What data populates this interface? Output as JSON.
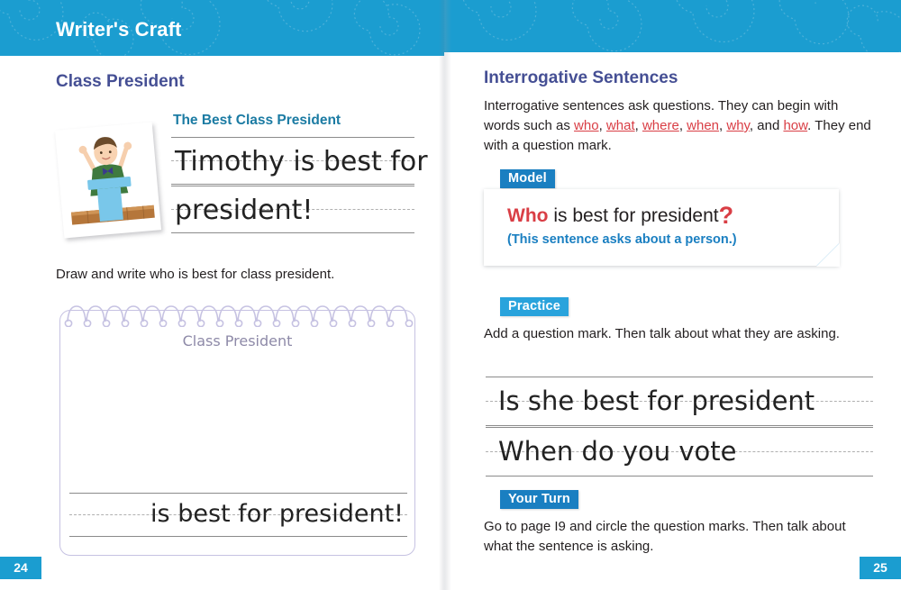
{
  "spread": {
    "band_title": "Writer's Craft",
    "left_page_number": "24",
    "right_page_number": "25"
  },
  "left_page": {
    "lesson_title": "Class President",
    "photo_caption_alt": "boy-at-podium-illustration",
    "sample_heading": "The Best Class President",
    "sample_lines": [
      "Timothy is best for",
      "president!"
    ],
    "instruction": "Draw and write who is best for class president.",
    "notepad": {
      "title": "Class President",
      "answer_line": "is best for president!",
      "spiral_rings": 19
    }
  },
  "right_page": {
    "section_title": "Interrogative Sentences",
    "intro": {
      "before": "Interrogative sentences ask questions. They can begin with words such as ",
      "question_words": [
        "who",
        "what",
        "where",
        "when",
        "why",
        "how"
      ],
      "joiner": ", ",
      "conjunction": ", and ",
      "after": ". They end with a question mark."
    },
    "model": {
      "chip_label": "Model",
      "red_word": "Who",
      "sentence": " is best for president",
      "question_mark": "?",
      "note": "(This sentence asks about a person.)"
    },
    "practice": {
      "chip_label": "Practice",
      "directions": "Add a question mark. Then talk about what they are asking.",
      "lines": [
        "Is she best for president",
        "When do you vote"
      ]
    },
    "your_turn": {
      "chip_label": "Your Turn",
      "directions": "Go to page I9 and circle the question marks. Then talk about what the sentence is asking."
    }
  },
  "colors": {
    "band_blue": "#1b9dd0",
    "heading_indigo": "#454f94",
    "subhead_teal": "#1b7ba3",
    "accent_red": "#d93e45",
    "chip_dark_blue": "#1a7fc1",
    "chip_light_blue": "#29a3dc",
    "notepad_purple": "#c6c2e2"
  }
}
